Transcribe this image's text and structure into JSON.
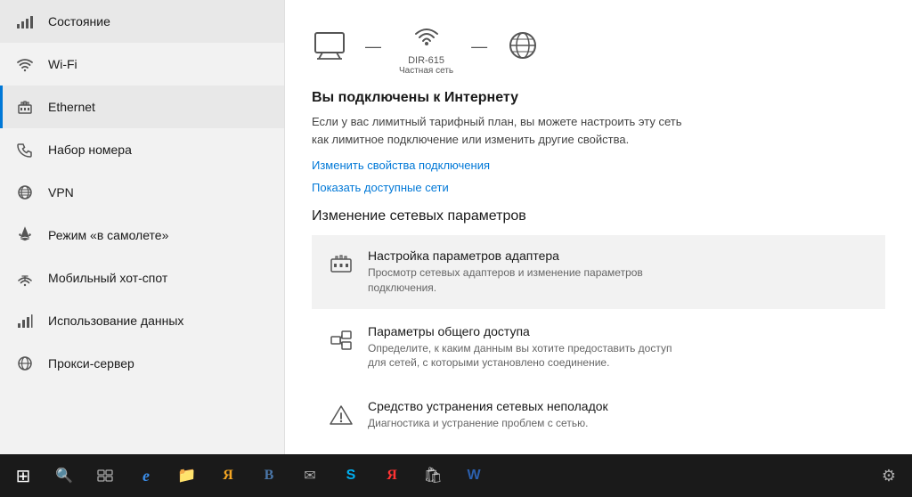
{
  "sidebar": {
    "items": [
      {
        "id": "status",
        "label": "Состояние",
        "icon": "wifi-status",
        "active": false
      },
      {
        "id": "wifi",
        "label": "Wi-Fi",
        "icon": "wifi",
        "active": false
      },
      {
        "id": "ethernet",
        "label": "Ethernet",
        "icon": "ethernet",
        "active": true
      },
      {
        "id": "dialup",
        "label": "Набор номера",
        "icon": "phone",
        "active": false
      },
      {
        "id": "vpn",
        "label": "VPN",
        "icon": "vpn",
        "active": false
      },
      {
        "id": "airplane",
        "label": "Режим «в самолете»",
        "icon": "airplane",
        "active": false
      },
      {
        "id": "hotspot",
        "label": "Мобильный хот-спот",
        "icon": "hotspot",
        "active": false
      },
      {
        "id": "datausage",
        "label": "Использование данных",
        "icon": "data",
        "active": false
      },
      {
        "id": "proxy",
        "label": "Прокси-сервер",
        "icon": "proxy",
        "active": false
      }
    ]
  },
  "content": {
    "router_name": "DIR-615",
    "router_network_type": "Частная сеть",
    "status_title": "Вы подключены к Интернету",
    "status_description": "Если у вас лимитный тарифный план, вы можете настроить эту сеть как лимитное подключение или изменить другие свойства.",
    "link_properties": "Изменить свойства подключения",
    "link_available": "Показать доступные сети",
    "section_title": "Изменение сетевых параметров",
    "cards": [
      {
        "title": "Настройка параметров адаптера",
        "description": "Просмотр сетевых адаптеров и изменение параметров подключения.",
        "icon": "adapter"
      },
      {
        "title": "Параметры общего доступа",
        "description": "Определите, к каким данным вы хотите предоставить доступ для сетей, с которыми установлено соединение.",
        "icon": "sharing"
      },
      {
        "title": "Средство устранения сетевых неполадок",
        "description": "Диагностика и устранение проблем с сетью.",
        "icon": "troubleshoot"
      }
    ]
  },
  "taskbar": {
    "buttons": [
      {
        "id": "start",
        "icon": "⊞",
        "label": "Start"
      },
      {
        "id": "search",
        "icon": "🔍",
        "label": "Search"
      },
      {
        "id": "taskview",
        "icon": "⧉",
        "label": "Task View"
      },
      {
        "id": "edge",
        "icon": "e",
        "label": "Edge",
        "color": "blue"
      },
      {
        "id": "files",
        "icon": "📁",
        "label": "Files",
        "color": "yellow"
      },
      {
        "id": "yandex",
        "icon": "Я",
        "label": "Yandex",
        "color": "red"
      },
      {
        "id": "vk",
        "icon": "В",
        "label": "VK",
        "color": "blue"
      },
      {
        "id": "mail",
        "icon": "✉",
        "label": "Mail"
      },
      {
        "id": "skype",
        "icon": "S",
        "label": "Skype",
        "color": "blue"
      },
      {
        "id": "yandex2",
        "icon": "Я",
        "label": "Yandex2",
        "color": "orange"
      },
      {
        "id": "store",
        "icon": "🛍",
        "label": "Store"
      },
      {
        "id": "word",
        "icon": "W",
        "label": "Word",
        "color": "blue"
      },
      {
        "id": "settings",
        "icon": "⚙",
        "label": "Settings"
      }
    ]
  }
}
